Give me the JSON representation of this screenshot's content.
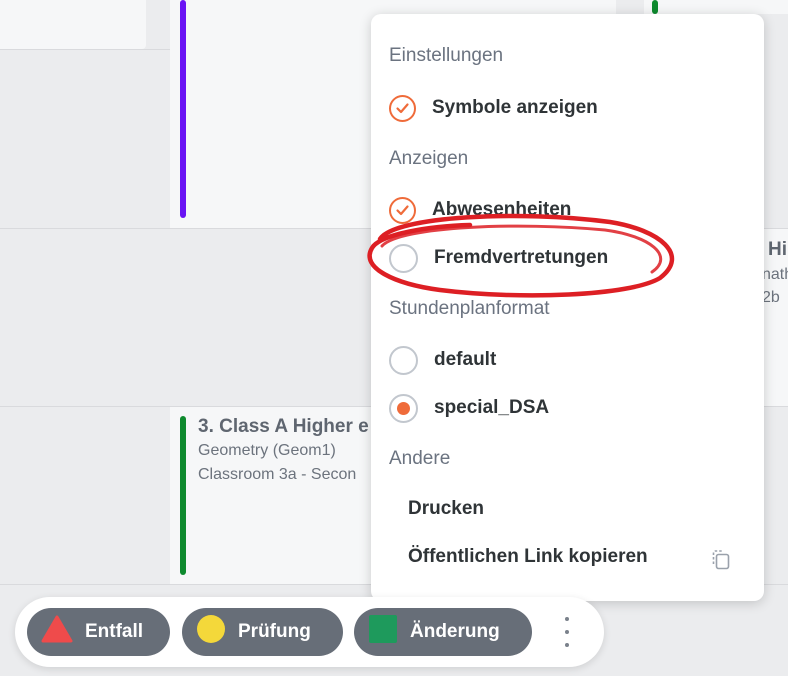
{
  "timetable": {
    "lesson_a": {
      "title": "3. Class A Higher e",
      "subject": "Geometry (Geom1)",
      "room": "Classroom 3a - Secon"
    },
    "lesson_b": {
      "title": "Hi",
      "subject": "nath",
      "room": "2b"
    },
    "colors": {
      "purple": "#6a14f4",
      "green": "#0e8a2e"
    }
  },
  "menu": {
    "settings_header": "Einstellungen",
    "show_symbols": {
      "label": "Symbole anzeigen",
      "checked": true
    },
    "display_header": "Anzeigen",
    "absences": {
      "label": "Abwesenheiten",
      "checked": true
    },
    "external_substitutions": {
      "label": "Fremdvertretungen",
      "checked": false
    },
    "format_header": "Stundenplanformat",
    "format_options": [
      {
        "label": "default",
        "selected": false
      },
      {
        "label": "special_DSA",
        "selected": true
      }
    ],
    "other_header": "Andere",
    "print_label": "Drucken",
    "copy_link_label": "Öffentlichen Link kopieren",
    "copy_icon": "copy-icon",
    "accent_color": "#ef6b3a",
    "annotation_color": "#dd1f24"
  },
  "legend": {
    "cancelled": {
      "label": "Entfall",
      "icon": "warning-triangle-icon",
      "color": "#ef4b4b"
    },
    "exam": {
      "label": "Prüfung",
      "icon": "yellow-circle-icon",
      "color": "#f4d83a"
    },
    "change": {
      "label": "Änderung",
      "icon": "green-square-icon",
      "color": "#1e9a5c"
    },
    "more_icon": "more-vertical-icon"
  }
}
